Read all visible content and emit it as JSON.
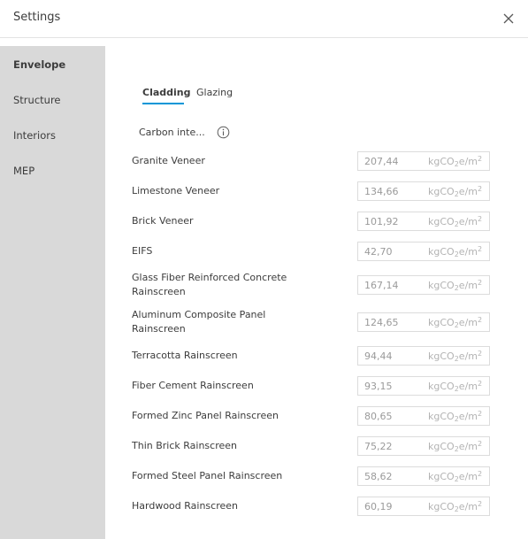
{
  "dialog": {
    "title": "Settings"
  },
  "sidebar": {
    "items": [
      {
        "label": "Envelope",
        "active": true
      },
      {
        "label": "Structure",
        "active": false
      },
      {
        "label": "Interiors",
        "active": false
      },
      {
        "label": "MEP",
        "active": false
      }
    ]
  },
  "tabs": [
    {
      "label": "Cladding",
      "active": true
    },
    {
      "label": "Glazing",
      "active": false
    }
  ],
  "section": {
    "label": "Carbon inte..."
  },
  "unit": {
    "prefix": "kgCO",
    "sub": "2",
    "mid": "e/m",
    "sup": "2"
  },
  "materials": [
    {
      "label": "Granite Veneer",
      "value": "207,44"
    },
    {
      "label": "Limestone Veneer",
      "value": "134,66"
    },
    {
      "label": "Brick Veneer",
      "value": "101,92"
    },
    {
      "label": "EIFS",
      "value": "42,70"
    },
    {
      "label": "Glass Fiber Reinforced Concrete Rainscreen",
      "value": "167,14"
    },
    {
      "label": "Aluminum Composite Panel Rainscreen",
      "value": "124,65"
    },
    {
      "label": "Terracotta Rainscreen",
      "value": "94,44"
    },
    {
      "label": "Fiber Cement Rainscreen",
      "value": "93,15"
    },
    {
      "label": "Formed Zinc Panel Rainscreen",
      "value": "80,65"
    },
    {
      "label": "Thin Brick Rainscreen",
      "value": "75,22"
    },
    {
      "label": "Formed Steel Panel Rainscreen",
      "value": "58,62"
    },
    {
      "label": "Hardwood Rainscreen",
      "value": "60,19"
    }
  ],
  "colors": {
    "accent": "#0696d7",
    "sidebar_bg": "#d9d9d9"
  },
  "icons": {
    "close": "close-icon",
    "info": "info-icon"
  }
}
